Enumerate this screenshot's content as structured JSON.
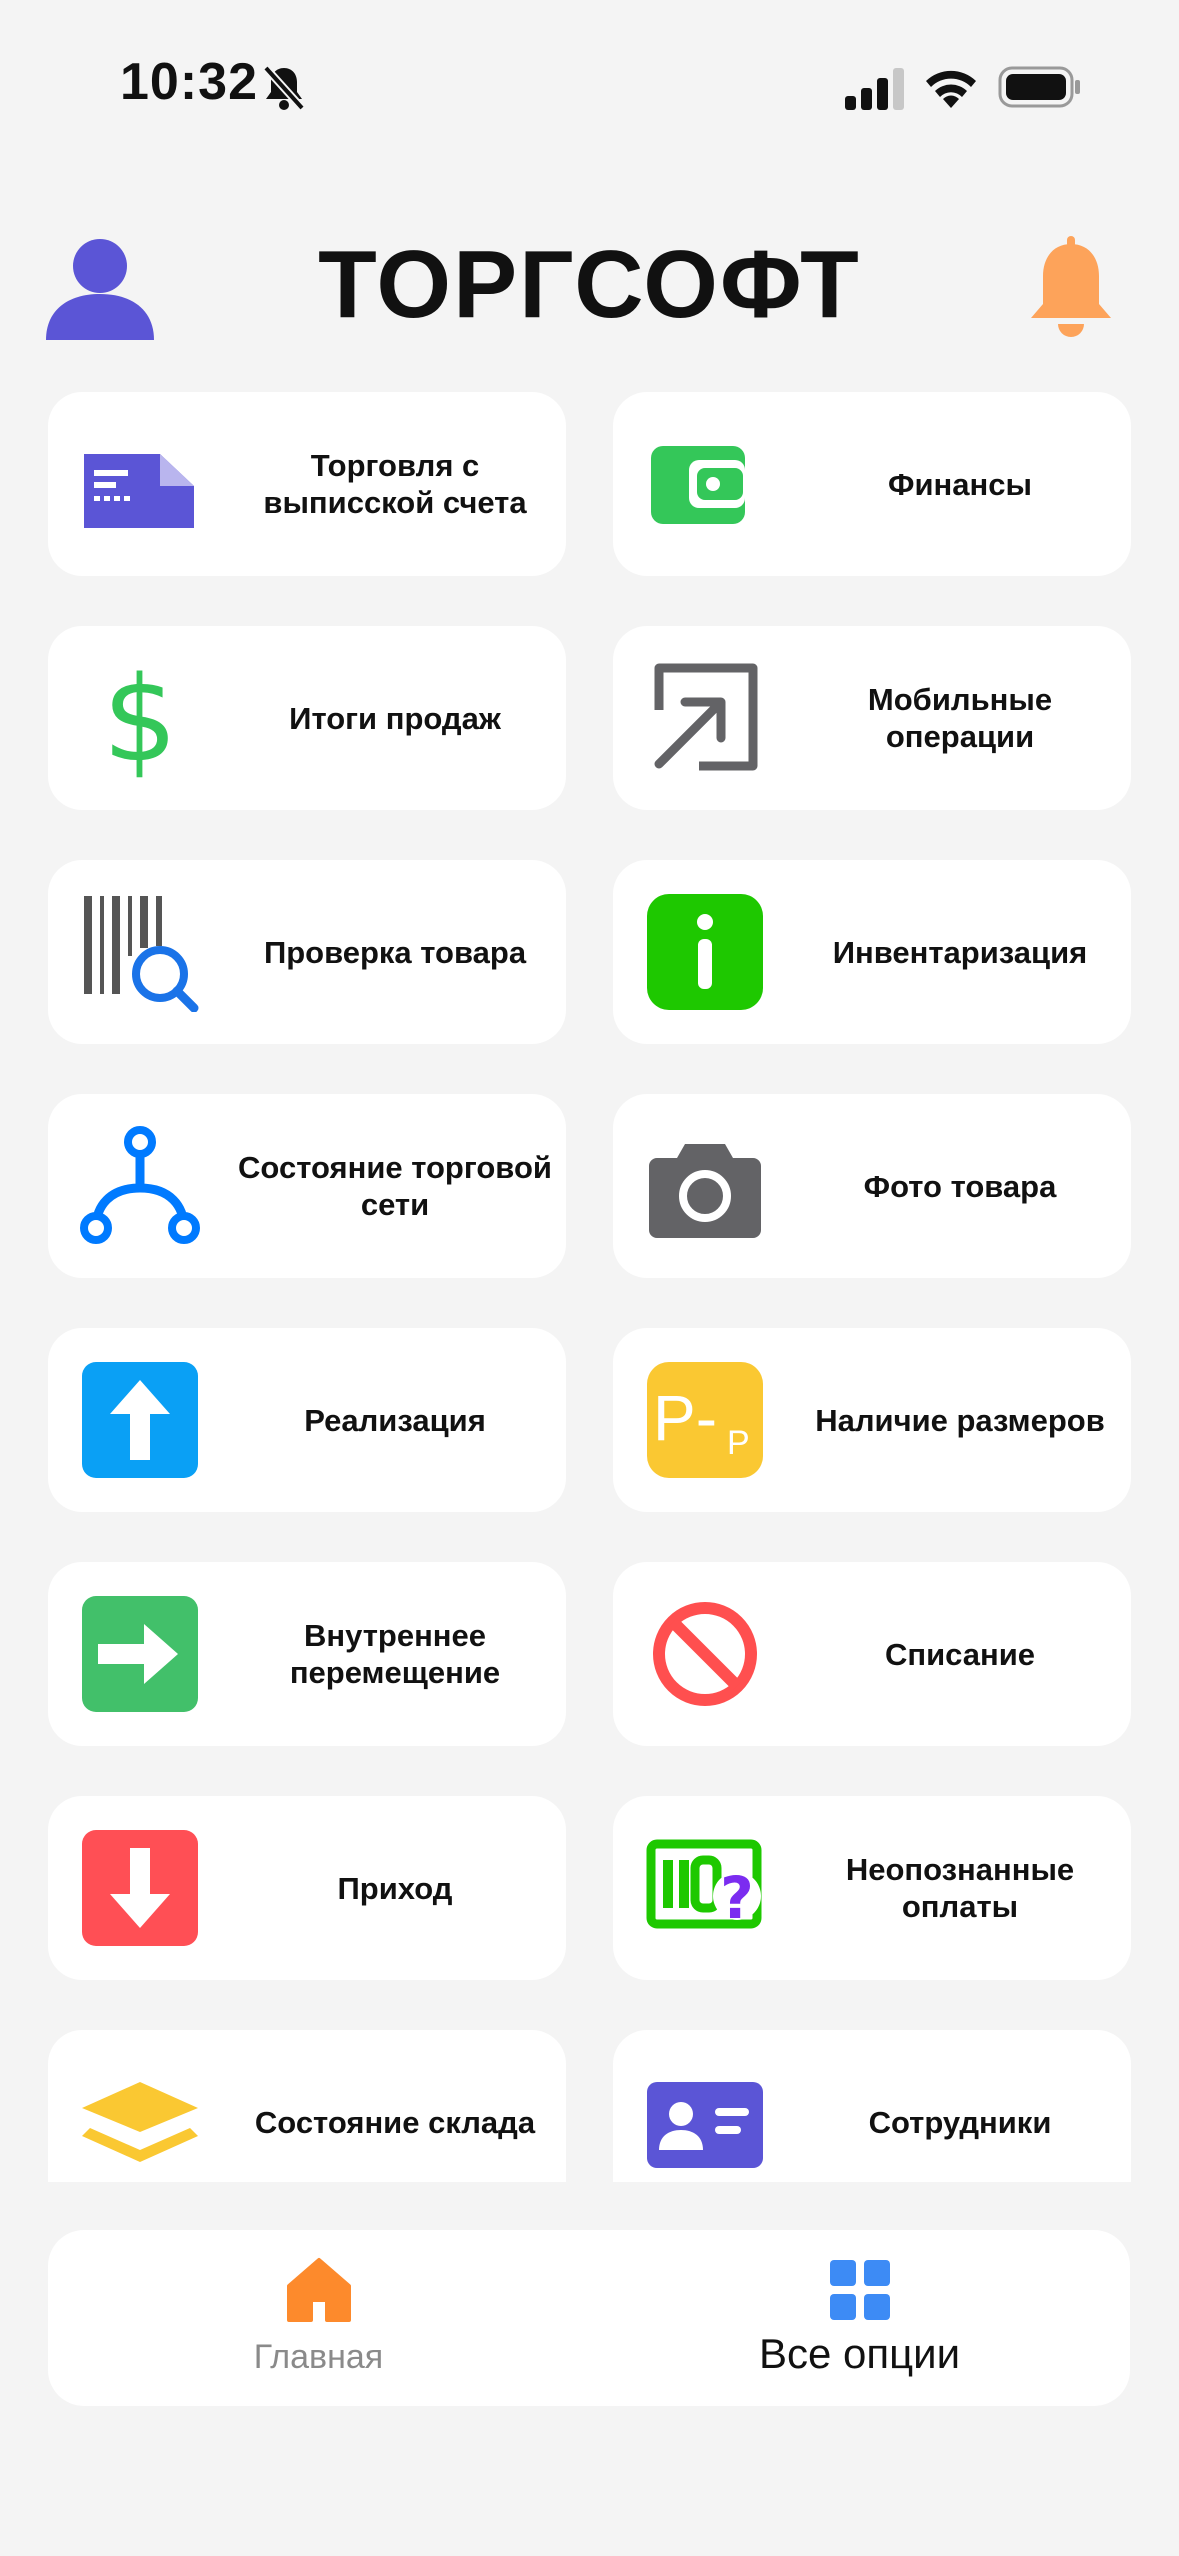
{
  "status_bar": {
    "time": "10:32"
  },
  "header": {
    "title": "ТОРГСОФТ"
  },
  "tiles": [
    {
      "label": "Торговля с выписской счета",
      "icon": "invoice-icon",
      "color": "#5b55d6"
    },
    {
      "label": "Финансы",
      "icon": "wallet-icon",
      "color": "#34c759"
    },
    {
      "label": "Итоги продаж",
      "icon": "dollar-icon",
      "color": "#34c759"
    },
    {
      "label": "Мобильные операции",
      "icon": "arrow-up-right-box-icon",
      "color": "#636366"
    },
    {
      "label": "Проверка товара",
      "icon": "barcode-search-icon",
      "color": "#1a73e8"
    },
    {
      "label": "Инвентаризация",
      "icon": "info-icon",
      "color": "#1ec800"
    },
    {
      "label": "Состояние торговой сети",
      "icon": "network-icon",
      "color": "#007aff"
    },
    {
      "label": "Фото товара",
      "icon": "camera-icon",
      "color": "#636366"
    },
    {
      "label": "Реализация",
      "icon": "arrow-up-icon",
      "color": "#0aa0f5"
    },
    {
      "label": "Наличие размеров",
      "icon": "sizes-icon",
      "color": "#fac832"
    },
    {
      "label": "Внутреннее перемещение",
      "icon": "arrow-right-icon",
      "color": "#42c06a"
    },
    {
      "label": "Списание",
      "icon": "prohibited-icon",
      "color": "#ff4f4f"
    },
    {
      "label": "Приход",
      "icon": "arrow-down-icon",
      "color": "#ff4f55"
    },
    {
      "label": "Неопознанные оплаты",
      "icon": "unknown-payment-icon",
      "color": "#1ec800"
    },
    {
      "label": "Состояние склада",
      "icon": "layers-icon",
      "color": "#fac832"
    },
    {
      "label": "Сотрудники",
      "icon": "id-card-icon",
      "color": "#5b55d6"
    }
  ],
  "tab_bar": {
    "home": {
      "label": "Главная",
      "icon": "home-icon"
    },
    "all": {
      "label": "Все опции",
      "icon": "grid-icon"
    }
  }
}
